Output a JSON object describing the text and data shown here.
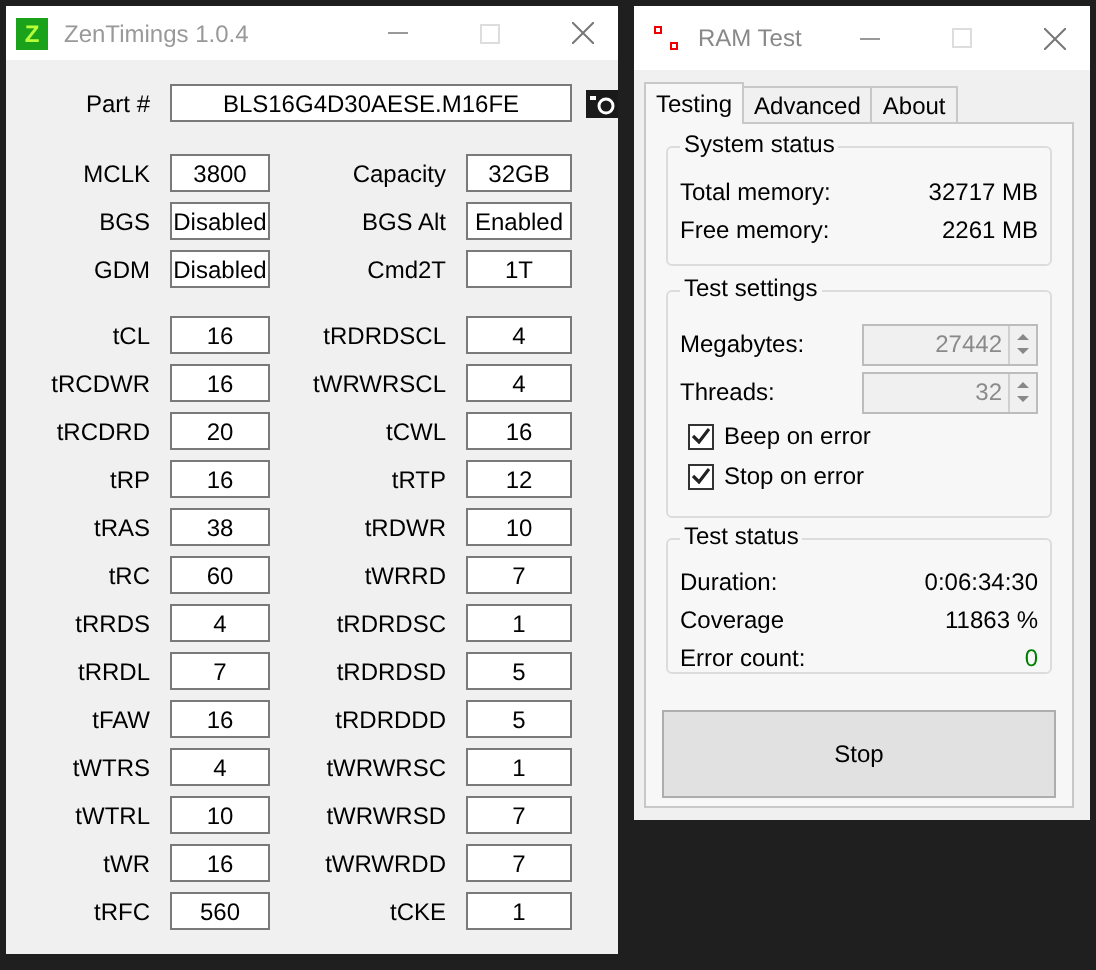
{
  "zentimings": {
    "title": "ZenTimings 1.0.4",
    "logo_letter": "Z",
    "part": {
      "label": "Part #",
      "value": "BLS16G4D30AESE.M16FE"
    },
    "info": [
      {
        "label": "MCLK",
        "value": "3800"
      },
      {
        "label": "Capacity",
        "value": "32GB"
      },
      {
        "label": "BGS",
        "value": "Disabled"
      },
      {
        "label": "BGS Alt",
        "value": "Enabled"
      },
      {
        "label": "GDM",
        "value": "Disabled"
      },
      {
        "label": "Cmd2T",
        "value": "1T"
      }
    ],
    "timings": [
      {
        "label": "tCL",
        "value": "16"
      },
      {
        "label": "tRDRDSCL",
        "value": "4"
      },
      {
        "label": "tRCDWR",
        "value": "16"
      },
      {
        "label": "tWRWRSCL",
        "value": "4"
      },
      {
        "label": "tRCDRD",
        "value": "20"
      },
      {
        "label": "tCWL",
        "value": "16"
      },
      {
        "label": "tRP",
        "value": "16"
      },
      {
        "label": "tRTP",
        "value": "12"
      },
      {
        "label": "tRAS",
        "value": "38"
      },
      {
        "label": "tRDWR",
        "value": "10"
      },
      {
        "label": "tRC",
        "value": "60"
      },
      {
        "label": "tWRRD",
        "value": "7"
      },
      {
        "label": "tRRDS",
        "value": "4"
      },
      {
        "label": "tRDRDSC",
        "value": "1"
      },
      {
        "label": "tRRDL",
        "value": "7"
      },
      {
        "label": "tRDRDSD",
        "value": "5"
      },
      {
        "label": "tFAW",
        "value": "16"
      },
      {
        "label": "tRDRDDD",
        "value": "5"
      },
      {
        "label": "tWTRS",
        "value": "4"
      },
      {
        "label": "tWRWRSC",
        "value": "1"
      },
      {
        "label": "tWTRL",
        "value": "10"
      },
      {
        "label": "tWRWRSD",
        "value": "7"
      },
      {
        "label": "tWR",
        "value": "16"
      },
      {
        "label": "tWRWRDD",
        "value": "7"
      },
      {
        "label": "tRFC",
        "value": "560"
      },
      {
        "label": "tCKE",
        "value": "1"
      }
    ]
  },
  "ramtest": {
    "title": "RAM Test",
    "tabs": [
      {
        "label": "Testing",
        "selected": true
      },
      {
        "label": "Advanced",
        "selected": false
      },
      {
        "label": "About",
        "selected": false
      }
    ],
    "system_status": {
      "title": "System status",
      "rows": [
        {
          "label": "Total memory:",
          "value": "32717 MB"
        },
        {
          "label": "Free memory:",
          "value": "2261 MB"
        }
      ]
    },
    "test_settings": {
      "title": "Test settings",
      "fields": [
        {
          "label": "Megabytes:",
          "value": "27442",
          "disabled": true
        },
        {
          "label": "Threads:",
          "value": "32",
          "disabled": true
        }
      ],
      "checkboxes": [
        {
          "label": "Beep on error",
          "checked": true
        },
        {
          "label": "Stop on error",
          "checked": true
        }
      ]
    },
    "test_status": {
      "title": "Test status",
      "rows": [
        {
          "label": "Duration:",
          "value": "0:06:34:30",
          "color": "#000000"
        },
        {
          "label": "Coverage",
          "value": "11863 %",
          "color": "#000000"
        },
        {
          "label": "Error count:",
          "value": "0",
          "color": "#008000"
        }
      ]
    },
    "button": "Stop"
  }
}
